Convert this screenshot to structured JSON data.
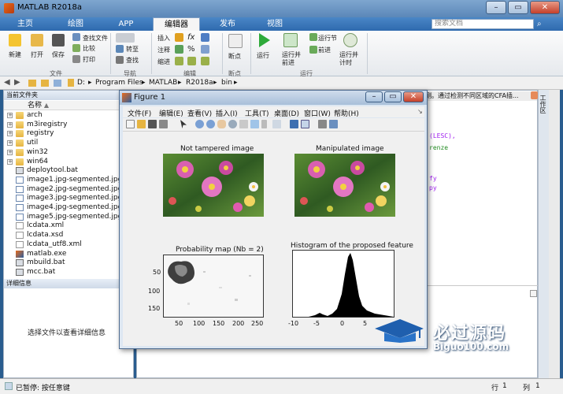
{
  "app": {
    "title": "MATLAB R2018a"
  },
  "tabs": [
    {
      "label": "主页"
    },
    {
      "label": "绘图"
    },
    {
      "label": "APP"
    },
    {
      "label": "编辑器"
    },
    {
      "label": "发布"
    },
    {
      "label": "视图"
    }
  ],
  "search": {
    "placeholder": "搜索文档"
  },
  "ribbon": {
    "file": {
      "new": "新建",
      "open": "打开",
      "save": "保存",
      "find_files": "查找文件",
      "compare": "比较",
      "print": "打印",
      "group": "文件"
    },
    "navigate": {
      "goto": "转至",
      "find": "查找",
      "group": "导航"
    },
    "edit": {
      "insert": "插入",
      "comment": "注释",
      "indent": "缩进",
      "fx": "fx",
      "percent": "%",
      "group": "编辑"
    },
    "breakpoints": {
      "label": "断点",
      "group": "断点"
    },
    "run": {
      "run": "运行",
      "run_advance": "运行并前进",
      "run_section": "运行节",
      "advance": "前进",
      "run_time": "运行并计时",
      "group": "运行"
    }
  },
  "address": {
    "parts": [
      "D:",
      "Program Files",
      "MATLAB",
      "R2018a",
      "bin"
    ]
  },
  "current_folder": {
    "title": "当前文件夹",
    "col_name": "名称",
    "files": [
      {
        "name": "arch",
        "type": "folder"
      },
      {
        "name": "m3iregistry",
        "type": "folder"
      },
      {
        "name": "registry",
        "type": "folder"
      },
      {
        "name": "util",
        "type": "folder"
      },
      {
        "name": "win32",
        "type": "folder"
      },
      {
        "name": "win64",
        "type": "folder"
      },
      {
        "name": "deploytool.bat",
        "type": "bat"
      },
      {
        "name": "image1.jpg-segmented.jpg",
        "type": "img"
      },
      {
        "name": "image2.jpg-segmented.jpg",
        "type": "img"
      },
      {
        "name": "image3.jpg-segmented.jpg",
        "type": "img"
      },
      {
        "name": "image4.jpg-segmented.jpg",
        "type": "img"
      },
      {
        "name": "image5.jpg-segmented.jpg",
        "type": "img"
      },
      {
        "name": "lcdata.xml",
        "type": "xml"
      },
      {
        "name": "lcdata.xsd",
        "type": "xml"
      },
      {
        "name": "lcdata_utf8.xml",
        "type": "xml"
      },
      {
        "name": "matlab.exe",
        "type": "exe"
      },
      {
        "name": "mbuild.bat",
        "type": "bat"
      },
      {
        "name": "mcc.bat",
        "type": "bat"
      }
    ],
    "detail_title": "详细信息",
    "detail_hint": "选择文件以查看详细信息"
  },
  "editor": {
    "strip_text": "测。通过检测不同区域的CFA插...",
    "code_lines": [
      "(LESC),",
      "renze",
      "fy",
      "py"
    ]
  },
  "workspace": {
    "label": "工作区"
  },
  "status": {
    "text": "已暂停: 按任意键",
    "row_label": "行",
    "row": "1",
    "col_label": "列",
    "col": "1"
  },
  "figure": {
    "title": "Figure 1",
    "menu": [
      "文件(F)",
      "编辑(E)",
      "查看(V)",
      "插入(I)",
      "工具(T)",
      "桌面(D)",
      "窗口(W)",
      "帮助(H)"
    ],
    "ax1_title": "Not tampered image",
    "ax2_title": "Manipulated image",
    "ax3_title": "Probability map (Nb = 2)",
    "ax4_title": "Histogram of the proposed feature",
    "ax3_yticks": [
      "50",
      "100",
      "150"
    ],
    "ax3_xticks": [
      "50",
      "100",
      "150",
      "200",
      "250"
    ],
    "ax4_xticks": [
      "-10",
      "-5",
      "0",
      "5"
    ]
  },
  "watermark": {
    "text": "必过源码",
    "url": "Biguo100.com"
  },
  "colors": {
    "accent": "#2f6aae",
    "ribbon_bg": "#f5f5f5",
    "figure_bg": "#f0f0f0"
  }
}
